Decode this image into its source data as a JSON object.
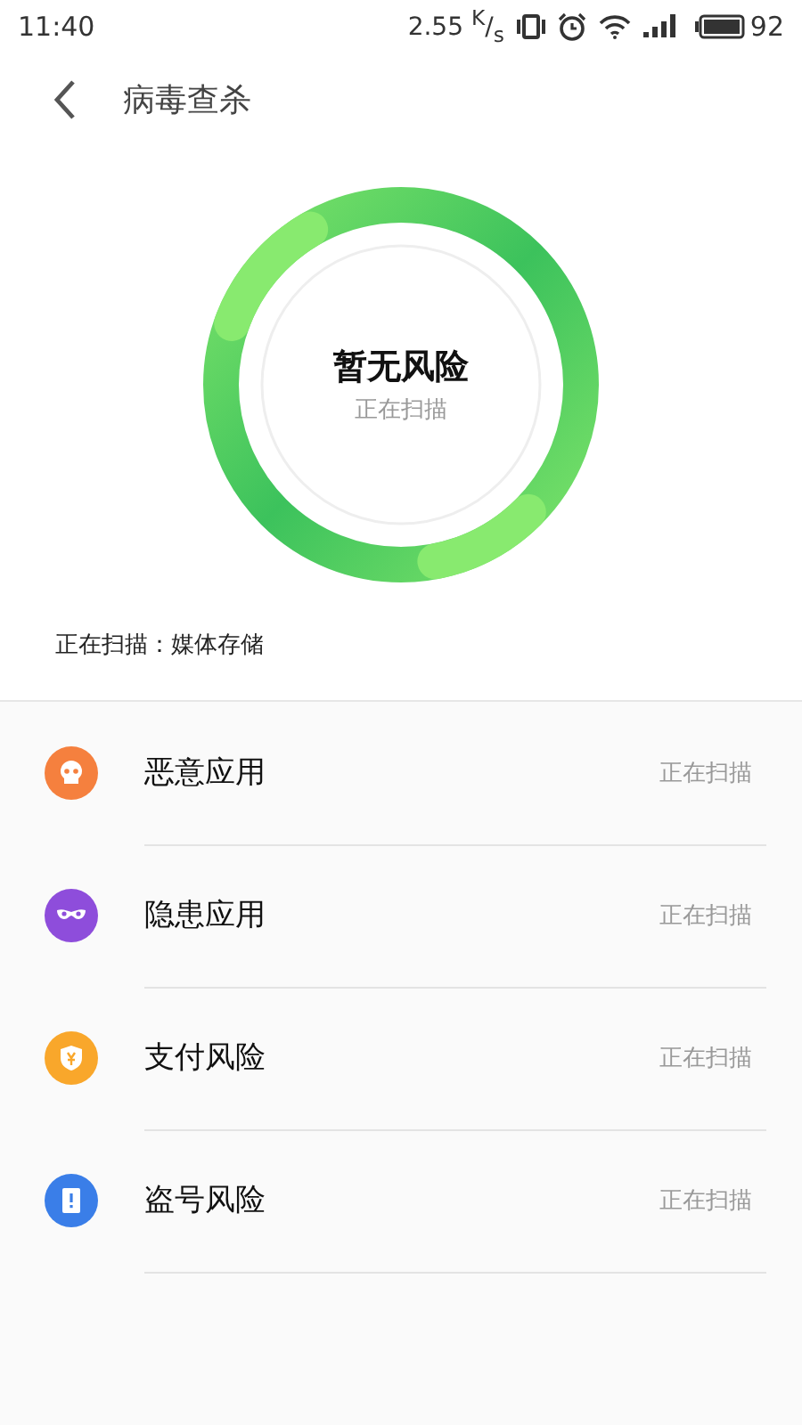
{
  "status_bar": {
    "time": "11:40",
    "speed": "2.55 $^{K}$/$_{s}$",
    "battery": "92"
  },
  "header": {
    "title": "病毒查杀"
  },
  "scan": {
    "result": "暂无风险",
    "state": "正在扫描",
    "current": "正在扫描：媒体存储"
  },
  "items": [
    {
      "kind": "malware",
      "label": "恶意应用",
      "status": "正在扫描",
      "color": "#f5803e"
    },
    {
      "kind": "privacy",
      "label": "隐患应用",
      "status": "正在扫描",
      "color": "#8e4ddb"
    },
    {
      "kind": "payment",
      "label": "支付风险",
      "status": "正在扫描",
      "color": "#f9a72b"
    },
    {
      "kind": "account",
      "label": "盗号风险",
      "status": "正在扫描",
      "color": "#3a7ee8"
    }
  ]
}
